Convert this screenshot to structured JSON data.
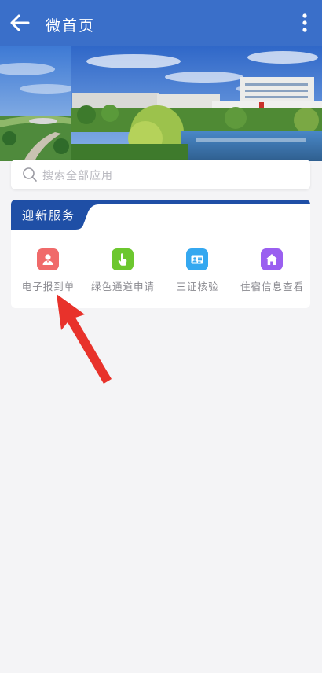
{
  "appbar": {
    "title": "微首页",
    "back_icon": "arrow-left-icon",
    "more_icon": "more-vertical-icon"
  },
  "search": {
    "placeholder": "搜索全部应用",
    "icon": "search-icon"
  },
  "services_card": {
    "title": "迎新服务",
    "items": [
      {
        "label": "电子报到单",
        "icon": "person-icon",
        "color": "#f06a6a"
      },
      {
        "label": "绿色通道申请",
        "icon": "hand-pointer-icon",
        "color": "#6cc72e"
      },
      {
        "label": "三证核验",
        "icon": "id-card-icon",
        "color": "#35a8f0"
      },
      {
        "label": "住宿信息查看",
        "icon": "home-icon",
        "color": "#9a5ff0"
      }
    ]
  },
  "colors": {
    "appbar": "#3a6fc9",
    "card_header": "#1f4fa6",
    "annotation_arrow": "#e8322b"
  }
}
